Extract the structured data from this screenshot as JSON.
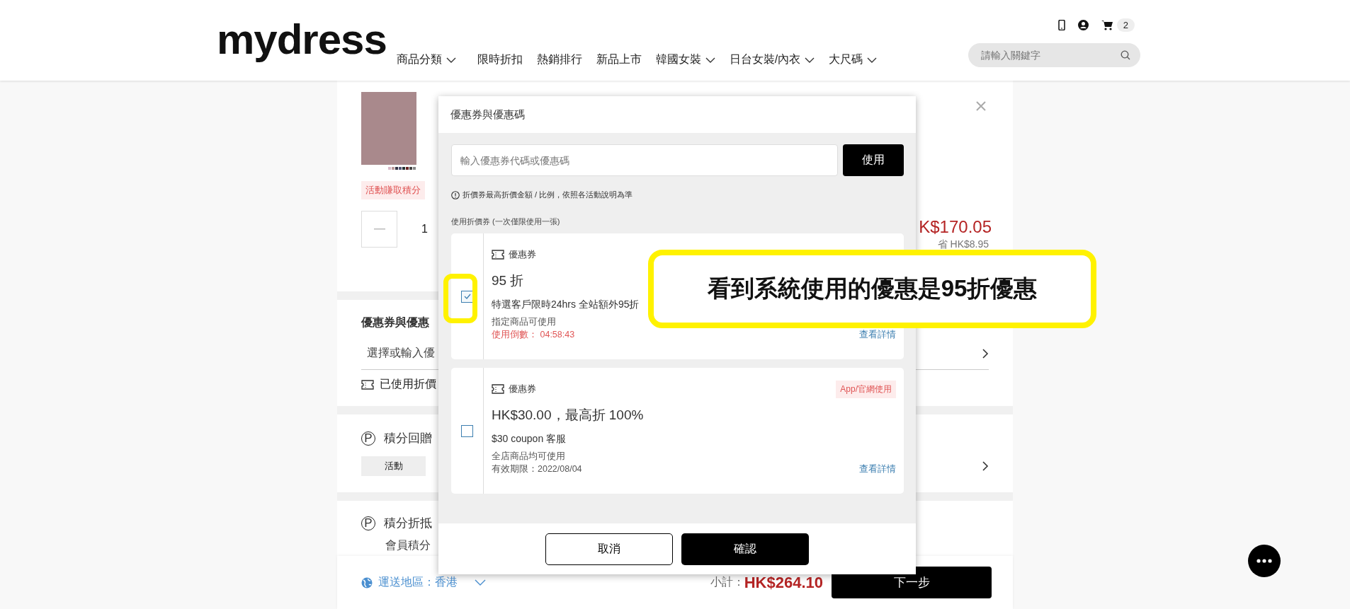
{
  "header": {
    "logo": "mydress",
    "nav": [
      {
        "label": "商品分類",
        "has_menu": true
      },
      {
        "label": "限時折扣",
        "has_menu": false
      },
      {
        "label": "熱銷排行",
        "has_menu": false
      },
      {
        "label": "新品上市",
        "has_menu": false
      },
      {
        "label": "韓國女裝",
        "has_menu": true
      },
      {
        "label": "日台女裝/內衣",
        "has_menu": true
      },
      {
        "label": "大尺碼",
        "has_menu": true
      }
    ],
    "cart_count": "2",
    "search": {
      "placeholder": "請輸入關鍵字"
    }
  },
  "product": {
    "tag": "活動賺取積分",
    "quantity": "1",
    "price": "K$170.05",
    "savings": "省 HK$8.95"
  },
  "coupon_section": {
    "title": "優惠券與優惠",
    "select_text": "選擇或輸入優",
    "used_text": "已使用折價"
  },
  "points": {
    "icon": "P",
    "title": "積分回贈",
    "badge": "活動",
    "redeem_icon": "P",
    "redeem_title": "積分折抵",
    "redeem_note": "會員積分"
  },
  "bottom_bar": {
    "region": "運送地區：香港",
    "subtotal_label": "小計：",
    "subtotal": "HK$264.10",
    "next_button": "下一步"
  },
  "modal": {
    "title": "優惠券與優惠碼",
    "code_placeholder": "輸入優惠券代碼或優惠碼",
    "apply_button": "使用",
    "notice": "折價券最高折價金額 / 比例，依照各活動說明為準",
    "list_label": "使用折價券 (一次僅限使用一張)",
    "coupons": [
      {
        "type_label": "優惠券",
        "headline": "95 折",
        "description": "特選客戶限時24hrs 全站額外95折",
        "scope": "指定商品可使用",
        "footnote": "使用倒數： 04:58:43",
        "kind": "countdown",
        "details_link": "查看詳情",
        "selected": true
      },
      {
        "type_label": "優惠券",
        "tag": "App/官網使用",
        "headline": "HK$30.00，最高折 100%",
        "description": "$30 coupon 客服",
        "scope": "全店商品均可使用",
        "footnote": "有效期限：2022/08/04",
        "kind": "expiry",
        "details_link": "查看詳情",
        "selected": false
      }
    ],
    "cancel_button": "取消",
    "confirm_button": "確認"
  },
  "annotation": {
    "text": "看到系統使用的優惠是95折優惠"
  }
}
